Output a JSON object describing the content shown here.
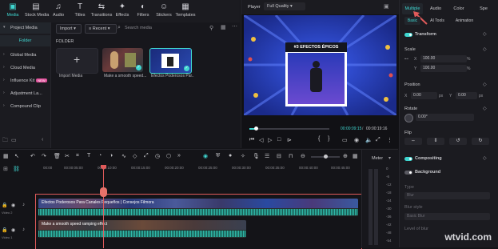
{
  "toolbar": {
    "items": [
      {
        "label": "Media",
        "icon": "media-icon"
      },
      {
        "label": "Stock Media",
        "icon": "stock-media-icon"
      },
      {
        "label": "Audio",
        "icon": "audio-icon"
      },
      {
        "label": "Titles",
        "icon": "titles-icon"
      },
      {
        "label": "Transitions",
        "icon": "transitions-icon"
      },
      {
        "label": "Effects",
        "icon": "effects-icon"
      },
      {
        "label": "Filters",
        "icon": "filters-icon"
      },
      {
        "label": "Stickers",
        "icon": "stickers-icon"
      },
      {
        "label": "Templates",
        "icon": "templates-icon"
      }
    ]
  },
  "sidebar": {
    "items": [
      "Project Media",
      "Global Media",
      "Cloud Media",
      "Influence Kit",
      "Adjustment La...",
      "Compound Clip"
    ],
    "folder": "Folder",
    "badge": "NEW"
  },
  "media": {
    "import_label": "Import",
    "sort_label": "Recent",
    "search_placeholder": "Search media",
    "folder_heading": "FOLDER",
    "cards": [
      {
        "caption": "Import Media"
      },
      {
        "caption": "Make a smooth speed..."
      },
      {
        "caption": "Efectos Poderosos Par..."
      }
    ]
  },
  "player": {
    "label": "Player",
    "quality": "Full Quality",
    "video_title": "#3 EFECTOS ÉPICOS",
    "current_time": "00:00:09:15",
    "total_time": "00:00:19:16"
  },
  "inspector": {
    "tabs": [
      "Multiple",
      "Audio",
      "Color",
      "Spe"
    ],
    "subtabs": [
      "Basic",
      "AI Tools",
      "Animation"
    ],
    "transform": "Transform",
    "scale": "Scale",
    "scale_x_label": "X",
    "scale_x": "100.00",
    "scale_y_label": "Y",
    "scale_y": "100.00",
    "unit_percent": "%",
    "position": "Position",
    "pos_x_label": "X",
    "pos_x": "0.00",
    "pos_y_label": "Y",
    "pos_y": "0.00",
    "unit_px": "px",
    "rotate": "Rotate",
    "rotate_value": "0.00°",
    "flip": "Flip",
    "compositing": "Compositing",
    "background": "Background",
    "type_label": "Type",
    "type_value": "Blur",
    "blur_style_label": "Blur style",
    "blur_style_value": "Basic Blur",
    "blur_level_label": "Level of blur"
  },
  "timeline": {
    "ruler": [
      "00:00",
      "00:00:05:00",
      "00:00:10:00",
      "00:00:15:00",
      "00:00:20:00",
      "00:00:25:00",
      "00:00:30:00",
      "00:00:35:00",
      "00:00:40:00",
      "00:00:45:00"
    ],
    "meter_label": "Meter",
    "meter_ticks": [
      "0",
      "-6",
      "-12",
      "-18",
      "-24",
      "-30",
      "-36",
      "-42",
      "-48",
      "-54"
    ],
    "track1_title": "Efectos Poderosos Para Canales Pequeños | Consejos Filmora",
    "track2_title": "Make a smooth speed ramping effect",
    "video1_label": "Video 2",
    "video2_label": "Video 1"
  },
  "watermark": "wtvid.com",
  "colors": {
    "accent": "#3fd6d0",
    "playhead": "#e05a5a",
    "selection": "#e05a5a"
  }
}
